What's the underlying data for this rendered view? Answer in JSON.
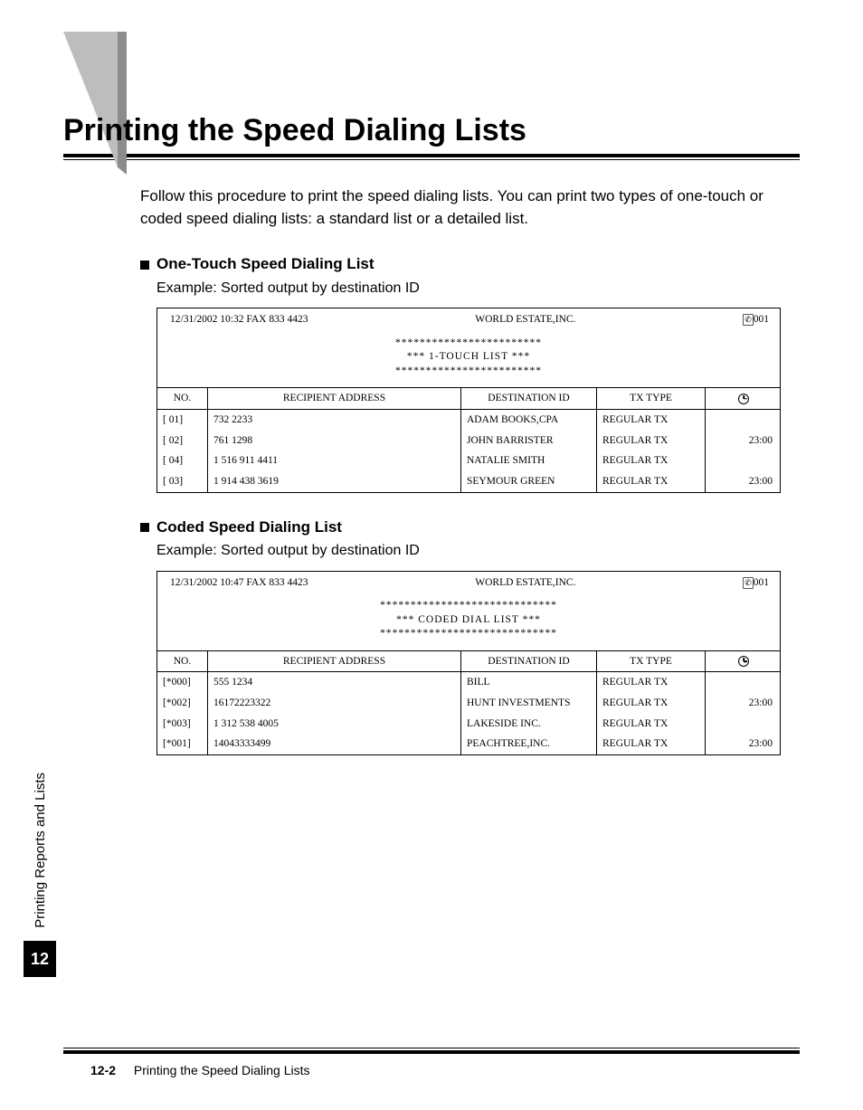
{
  "page": {
    "title": "Printing the Speed Dialing Lists",
    "intro": "Follow this procedure to print the speed dialing lists. You can print two types of one-touch or coded speed dialing lists: a standard list or a detailed list.",
    "tab_label": "Printing Reports and Lists",
    "chapter_number": "12",
    "footer_page": "12-2",
    "footer_title": "Printing the Speed Dialing Lists"
  },
  "sections": [
    {
      "heading": "One-Touch Speed Dialing List",
      "subheading": "Example: Sorted output by destination ID",
      "report": {
        "header_left": "12/31/2002    10:32    FAX  833  4423",
        "header_center": "WORLD  ESTATE,INC.",
        "header_right_num": "001",
        "banner_stars_top": "************************",
        "banner_line": "***      1-TOUCH  LIST      ***",
        "banner_stars_bot": "************************",
        "columns": {
          "no": "NO.",
          "addr": "RECIPIENT  ADDRESS",
          "dest": "DESTINATION  ID",
          "tx": "TX  TYPE"
        },
        "rows": [
          {
            "no": "[    01]",
            "addr": "732  2233",
            "dest": "ADAM  BOOKS,CPA",
            "tx": "REGULAR  TX",
            "time": ""
          },
          {
            "no": "[    02]",
            "addr": "761  1298",
            "dest": "JOHN  BARRISTER",
            "tx": "REGULAR  TX",
            "time": "23:00"
          },
          {
            "no": "[    04]",
            "addr": "1  516  911  4411",
            "dest": "NATALIE  SMITH",
            "tx": "REGULAR  TX",
            "time": ""
          },
          {
            "no": "[    03]",
            "addr": "1  914  438  3619",
            "dest": "SEYMOUR  GREEN",
            "tx": "REGULAR  TX",
            "time": "23:00"
          }
        ]
      }
    },
    {
      "heading": "Coded Speed Dialing List",
      "subheading": "Example: Sorted output by destination ID",
      "report": {
        "header_left": "12/31/2002    10:47    FAX  833  4423",
        "header_center": "WORLD  ESTATE,INC.",
        "header_right_num": "001",
        "banner_stars_top": "*****************************",
        "banner_line": "***      CODED  DIAL  LIST      ***",
        "banner_stars_bot": "*****************************",
        "columns": {
          "no": "NO.",
          "addr": "RECIPIENT ADDRESS",
          "dest": "DESTINATION  ID",
          "tx": "TX  TYPE"
        },
        "rows": [
          {
            "no": "[*000]",
            "addr": "555  1234",
            "dest": "BILL",
            "tx": "REGULAR  TX",
            "time": ""
          },
          {
            "no": "[*002]",
            "addr": "16172223322",
            "dest": "HUNT  INVESTMENTS",
            "tx": "REGULAR  TX",
            "time": "23:00"
          },
          {
            "no": "[*003]",
            "addr": "1  312  538  4005",
            "dest": "LAKESIDE  INC.",
            "tx": "REGULAR  TX",
            "time": ""
          },
          {
            "no": "[*001]",
            "addr": "14043333499",
            "dest": "PEACHTREE,INC.",
            "tx": "REGULAR  TX",
            "time": "23:00"
          }
        ]
      }
    }
  ]
}
